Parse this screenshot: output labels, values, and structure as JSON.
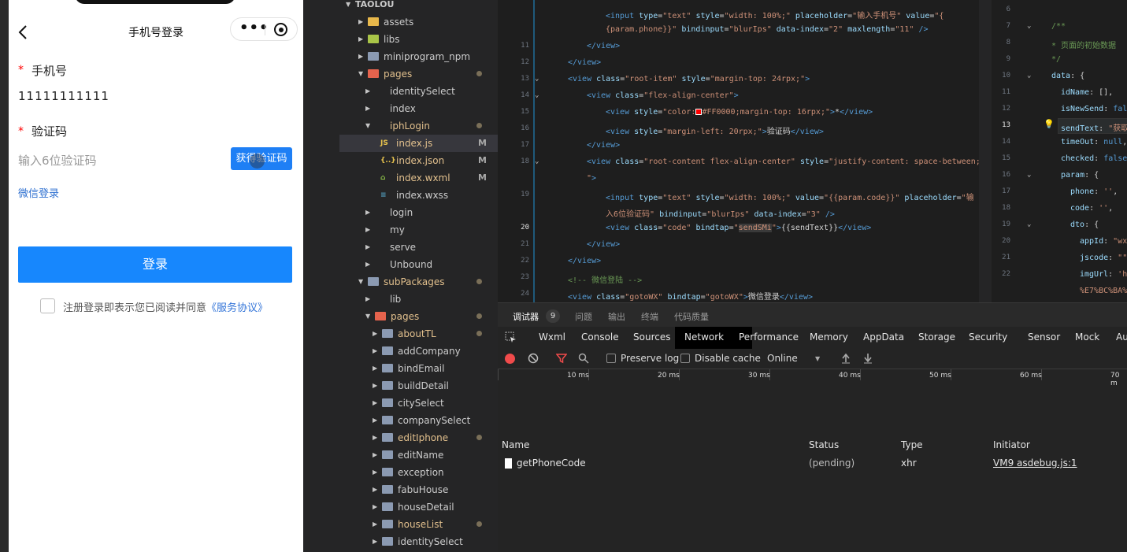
{
  "simulator": {
    "nav_title": "手机号登录",
    "capsule_more": "•••",
    "phone_label": "手机号",
    "phone_value": "11111111111",
    "code_label": "验证码",
    "code_placeholder": "输入6位验证码",
    "send_code": "获得验证码",
    "required_mark": "*",
    "wechat_login": "微信登录",
    "login_button": "登录",
    "agree_text": "注册登录即表示您已阅读并同意",
    "agree_link": "《服务协议》"
  },
  "explorer": {
    "root": "TAOLOU",
    "items": [
      {
        "label": "assets",
        "type": "folder-yellow",
        "level": 1,
        "open": false,
        "status": ""
      },
      {
        "label": "libs",
        "type": "folder-green",
        "level": 1,
        "open": false,
        "status": ""
      },
      {
        "label": "miniprogram_npm",
        "type": "folder",
        "level": 1,
        "open": false,
        "status": ""
      },
      {
        "label": "pages",
        "type": "folder-red",
        "level": 1,
        "open": true,
        "status": "dot"
      },
      {
        "label": "identitySelect",
        "type": "none",
        "level": 2,
        "open": false,
        "status": ""
      },
      {
        "label": "index",
        "type": "none",
        "level": 2,
        "open": false,
        "status": ""
      },
      {
        "label": "iphLogin",
        "type": "none",
        "level": 2,
        "open": true,
        "status": "dot"
      },
      {
        "label": "index.js",
        "type": "js",
        "level": 3,
        "open": false,
        "status": "M"
      },
      {
        "label": "index.json",
        "type": "json",
        "level": 3,
        "open": false,
        "status": "M"
      },
      {
        "label": "index.wxml",
        "type": "wxml",
        "level": 3,
        "open": false,
        "status": "M"
      },
      {
        "label": "index.wxss",
        "type": "wxss",
        "level": 3,
        "open": false,
        "status": ""
      },
      {
        "label": "login",
        "type": "none",
        "level": 2,
        "open": false,
        "status": ""
      },
      {
        "label": "my",
        "type": "none",
        "level": 2,
        "open": false,
        "status": ""
      },
      {
        "label": "serve",
        "type": "none",
        "level": 2,
        "open": false,
        "status": ""
      },
      {
        "label": "Unbound",
        "type": "none",
        "level": 2,
        "open": false,
        "status": ""
      },
      {
        "label": "subPackages",
        "type": "folder",
        "level": 1,
        "open": true,
        "status": "dot"
      },
      {
        "label": "lib",
        "type": "none",
        "level": 2,
        "open": false,
        "status": ""
      },
      {
        "label": "pages",
        "type": "folder-red",
        "level": 2,
        "open": true,
        "status": "dot"
      },
      {
        "label": "aboutTL",
        "type": "folder",
        "level": 3,
        "open": false,
        "status": "dot"
      },
      {
        "label": "addCompany",
        "type": "folder",
        "level": 3,
        "open": false,
        "status": ""
      },
      {
        "label": "bindEmail",
        "type": "folder",
        "level": 3,
        "open": false,
        "status": ""
      },
      {
        "label": "buildDetail",
        "type": "folder",
        "level": 3,
        "open": false,
        "status": ""
      },
      {
        "label": "citySelect",
        "type": "folder",
        "level": 3,
        "open": false,
        "status": ""
      },
      {
        "label": "companySelect",
        "type": "folder",
        "level": 3,
        "open": false,
        "status": ""
      },
      {
        "label": "editIphone",
        "type": "folder",
        "level": 3,
        "open": false,
        "status": "dot"
      },
      {
        "label": "editName",
        "type": "folder",
        "level": 3,
        "open": false,
        "status": ""
      },
      {
        "label": "exception",
        "type": "folder",
        "level": 3,
        "open": false,
        "status": ""
      },
      {
        "label": "fabuHouse",
        "type": "folder",
        "level": 3,
        "open": false,
        "status": ""
      },
      {
        "label": "houseDetail",
        "type": "folder",
        "level": 3,
        "open": false,
        "status": ""
      },
      {
        "label": "houseList",
        "type": "folder",
        "level": 3,
        "open": false,
        "status": "dot"
      },
      {
        "label": "identitySelect",
        "type": "folder",
        "level": 3,
        "open": false,
        "status": ""
      }
    ],
    "selected_index": 7
  },
  "editor_wxml": {
    "lines": [
      {
        "n": "",
        "html": "<span class=\"tg\">&lt;input</span> <span class=\"at\">type</span>=<span class=\"st\">\"text\"</span> <span class=\"at\">style</span>=<span class=\"st\">\"width: 100%;\"</span> <span class=\"at\">placeholder</span>=<span class=\"st\">\"输入手机号\"</span> <span class=\"at\">value</span>=<span class=\"st\">\"{</span>",
        "ind": 48,
        "fold": false
      },
      {
        "n": "",
        "html": "<span class=\"st\">{param.phone}}\"</span> <span class=\"at\">bindinput</span>=<span class=\"st\">\"blurIps\"</span> <span class=\"at\">data-index</span>=<span class=\"st\">\"2\"</span> <span class=\"at\">maxlength</span>=<span class=\"st\">\"11\"</span> <span class=\"tg\">/&gt;</span>",
        "ind": 48,
        "fold": false
      },
      {
        "n": "11",
        "html": "<span class=\"tg\">&lt;/view&gt;</span>",
        "ind": 24,
        "fold": false
      },
      {
        "n": "12",
        "html": "<span class=\"tg\">&lt;/view&gt;</span>",
        "ind": 0,
        "fold": false
      },
      {
        "n": "13",
        "html": "<span class=\"tg\">&lt;view</span> <span class=\"at\">class</span>=<span class=\"st\">\"root-item\"</span> <span class=\"at\">style</span>=<span class=\"st\">\"margin-top: 24rpx;\"</span><span class=\"tg\">&gt;</span>",
        "ind": 0,
        "fold": true
      },
      {
        "n": "14",
        "html": "<span class=\"tg\">&lt;view</span> <span class=\"at\">class</span>=<span class=\"st\">\"flex-align-center\"</span><span class=\"tg\">&gt;</span>",
        "ind": 24,
        "fold": true
      },
      {
        "n": "15",
        "html": "<span class=\"tg\">&lt;view</span> <span class=\"at\">style</span>=<span class=\"st\">\"color:<span style=\"display:inline-block;width:8px;height:8px;background:#f00;border:1px solid #fff;vertical-align:-1px\"></span>#FF0000;margin-top: 16rpx;\"</span><span class=\"tg\">&gt;</span>*<span class=\"tg\">&lt;/view&gt;</span>",
        "ind": 48,
        "fold": false
      },
      {
        "n": "16",
        "html": "<span class=\"tg\">&lt;view</span> <span class=\"at\">style</span>=<span class=\"st\">\"margin-left: 20rpx;\"</span><span class=\"tg\">&gt;</span>验证码<span class=\"tg\">&lt;/view&gt;</span>",
        "ind": 48,
        "fold": false
      },
      {
        "n": "17",
        "html": "<span class=\"tg\">&lt;/view&gt;</span>",
        "ind": 24,
        "fold": false
      },
      {
        "n": "18",
        "html": "<span class=\"tg\">&lt;view</span> <span class=\"at\">class</span>=<span class=\"st\">\"root-content flex-align-center\"</span> <span class=\"at\">style</span>=<span class=\"st\">\"justify-content: space-between;</span>",
        "ind": 24,
        "fold": true
      },
      {
        "n": "",
        "html": "<span class=\"st\">\"</span><span class=\"tg\">&gt;</span>",
        "ind": 24,
        "fold": false
      },
      {
        "n": "19",
        "html": "<span class=\"tg\">&lt;input</span> <span class=\"at\">type</span>=<span class=\"st\">\"text\"</span> <span class=\"at\">style</span>=<span class=\"st\">\"width: 100%;\"</span> <span class=\"at\">value</span>=<span class=\"st\">\"{{param.code}}\"</span> <span class=\"at\">placeholder</span>=<span class=\"st\">\"输</span>",
        "ind": 48,
        "fold": false
      },
      {
        "n": "",
        "html": "<span class=\"st\">入6位验证码\"</span> <span class=\"at\">bindinput</span>=<span class=\"st\">\"blurIps\"</span> <span class=\"at\">data-index</span>=<span class=\"st\">\"3\"</span> <span class=\"tg\">/&gt;</span>",
        "ind": 48,
        "fold": false
      },
      {
        "n": "20",
        "html": "<span class=\"tg\">&lt;view</span> <span class=\"at\">class</span>=<span class=\"st\">\"code\"</span> <span class=\"at\">bindtap</span>=<span class=\"st\">\"<span style=\"background:#3a3a3a\">sendSMi</span>\"</span><span class=\"tg\">&gt;</span><span class=\"wt\">{{sendText}}</span><span class=\"tg\">&lt;/view&gt;</span>",
        "ind": 48,
        "fold": false
      },
      {
        "n": "21",
        "html": "<span class=\"tg\">&lt;/view&gt;</span>",
        "ind": 24,
        "fold": false
      },
      {
        "n": "22",
        "html": "<span class=\"tg\">&lt;/view&gt;</span>",
        "ind": 0,
        "fold": false
      },
      {
        "n": "23",
        "html": "<span class=\"cm\">&lt;!-- 微信登陆 --&gt;</span>",
        "ind": 0,
        "fold": false
      },
      {
        "n": "24",
        "html": "<span class=\"tg\">&lt;view</span> <span class=\"at\">class</span>=<span class=\"st\">\"gotoWX\"</span> <span class=\"at\">bindtap</span>=<span class=\"st\">\"gotoWX\"</span><span class=\"tg\">&gt;</span>微信登录<span class=\"tg\">&lt;/view&gt;</span>",
        "ind": 0,
        "fold": false
      }
    ]
  },
  "editor_js": {
    "lines": [
      {
        "n": "6",
        "html": "",
        "ind": 0,
        "fold": false
      },
      {
        "n": "7",
        "html": "<span class=\"cm\">/**</span>",
        "ind": 0,
        "fold": true
      },
      {
        "n": "8",
        "html": "<span class=\"cm\"> * 页面的初始数据</span>",
        "ind": 0,
        "fold": false
      },
      {
        "n": "9",
        "html": "<span class=\"cm\"> */</span>",
        "ind": 0,
        "fold": false
      },
      {
        "n": "10",
        "html": "<span class=\"ky\">data</span>: {",
        "ind": 0,
        "fold": true
      },
      {
        "n": "11",
        "html": "<span class=\"ky\">idName</span>: [],",
        "ind": 12,
        "fold": false
      },
      {
        "n": "12",
        "html": "<span class=\"ky\">isNewSend</span>: <span class=\"kw\">false</span>",
        "ind": 12,
        "fold": false
      },
      {
        "n": "13",
        "html": "<span class=\"ky\">sendText</span>: <span class=\"st\">\"获取</span>",
        "ind": 12,
        "fold": false
      },
      {
        "n": "14",
        "html": "<span class=\"ky\">timeOut</span>: <span class=\"kw\">null</span>,",
        "ind": 12,
        "fold": false
      },
      {
        "n": "15",
        "html": "<span class=\"ky\">checked</span>: <span class=\"kw\">false</span>",
        "ind": 12,
        "fold": false
      },
      {
        "n": "16",
        "html": "<span class=\"ky\">param</span>: {",
        "ind": 12,
        "fold": true
      },
      {
        "n": "17",
        "html": "<span class=\"ky\">phone</span>: <span class=\"st\">''</span>,",
        "ind": 24,
        "fold": false
      },
      {
        "n": "18",
        "html": "<span class=\"ky\">code</span>: <span class=\"st\">''</span>,",
        "ind": 24,
        "fold": false
      },
      {
        "n": "19",
        "html": "<span class=\"ky\">dto</span>: {",
        "ind": 24,
        "fold": true
      },
      {
        "n": "20",
        "html": "<span class=\"ky\">appId</span>: <span class=\"st\">\"wx</span>",
        "ind": 36,
        "fold": false
      },
      {
        "n": "21",
        "html": "<span class=\"ky\">jscode</span>: <span class=\"st\">\"\"</span>",
        "ind": 36,
        "fold": false
      },
      {
        "n": "22",
        "html": "<span class=\"ky\">imgUrl</span>: <span class=\"st\">'ht</span>",
        "ind": 36,
        "fold": false
      },
      {
        "n": "",
        "html": "<span class=\"st\">%E7%BC%BA%</span>",
        "ind": 36,
        "fold": false
      }
    ]
  },
  "devtools": {
    "top_tabs": [
      "调试器",
      "问题",
      "输出",
      "终端",
      "代码质量"
    ],
    "debugger_count": "9",
    "panel_tabs": [
      "Wxml",
      "Console",
      "Sources",
      "Network",
      "Performance",
      "Memory",
      "AppData",
      "Storage",
      "Security",
      "Sensor",
      "Mock",
      "Au"
    ],
    "active_panel": "Network",
    "toolbar": {
      "preserve_log": "Preserve log",
      "disable_cache": "Disable cache",
      "throttle": "Online"
    },
    "timeline_ticks": [
      "10 ms",
      "20 ms",
      "30 ms",
      "40 ms",
      "50 ms",
      "60 ms",
      "70 m"
    ],
    "columns": [
      "Name",
      "Status",
      "Type",
      "Initiator"
    ],
    "rows": [
      {
        "name": "getPhoneCode",
        "status": "(pending)",
        "type": "xhr",
        "initiator": "VM9 asdebug.js:1"
      }
    ]
  },
  "colors": {
    "accent": "#1787fd",
    "required": "#ff0000",
    "link": "#3274d8"
  }
}
